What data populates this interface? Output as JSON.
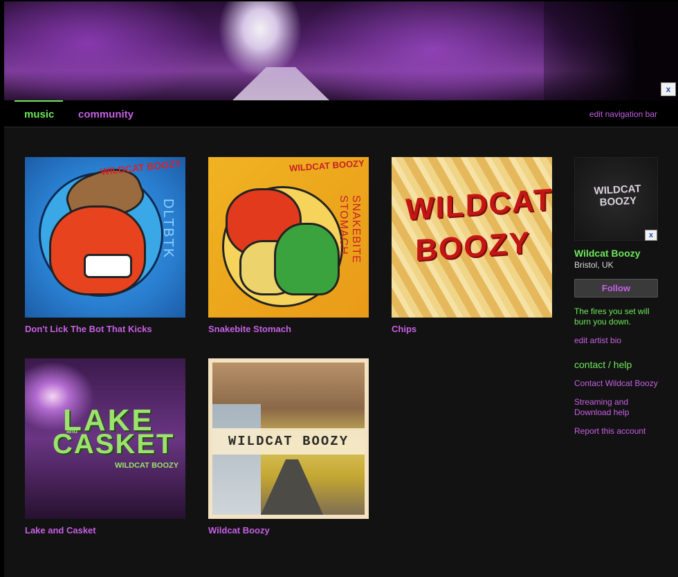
{
  "header": {
    "close_label": "x"
  },
  "nav": {
    "tabs": [
      {
        "label": "music"
      },
      {
        "label": "community"
      }
    ],
    "edit_label": "edit navigation bar"
  },
  "albums": [
    {
      "title": "Don't Lick The Bot That Kicks",
      "art_text": "WILDCAT BOOZY",
      "art_script": "DLTBTK"
    },
    {
      "title": "Snakebite Stomach",
      "art_text": "WILDCAT BOOZY",
      "art_script": "SNAKEBITE STOMACH"
    },
    {
      "title": "Chips",
      "art_text": "WILDCAT BOOZY"
    },
    {
      "title": "Lake and Casket",
      "art_line1": "LAKE",
      "art_small": "and",
      "art_line2": "CASKET",
      "art_sub": "WILDCAT BOOZY"
    },
    {
      "title": "Wildcat Boozy",
      "art_text": "WILDCAT BOOZY"
    }
  ],
  "sidebar": {
    "photo_logo": "WILDCAT BOOZY",
    "close_label": "x",
    "artist_name": "Wildcat Boozy",
    "location": "Bristol, UK",
    "follow_label": "Follow",
    "bio": "The fires you set will burn you down.",
    "edit_bio_label": "edit artist bio",
    "contact_heading": "contact / help",
    "links": [
      {
        "label": "Contact Wildcat Boozy"
      },
      {
        "label": "Streaming and Download help"
      },
      {
        "label": "Report this account"
      }
    ]
  },
  "colors": {
    "accent_green": "#6ee85a",
    "link_purple": "#c760e5",
    "background": "#121212"
  }
}
